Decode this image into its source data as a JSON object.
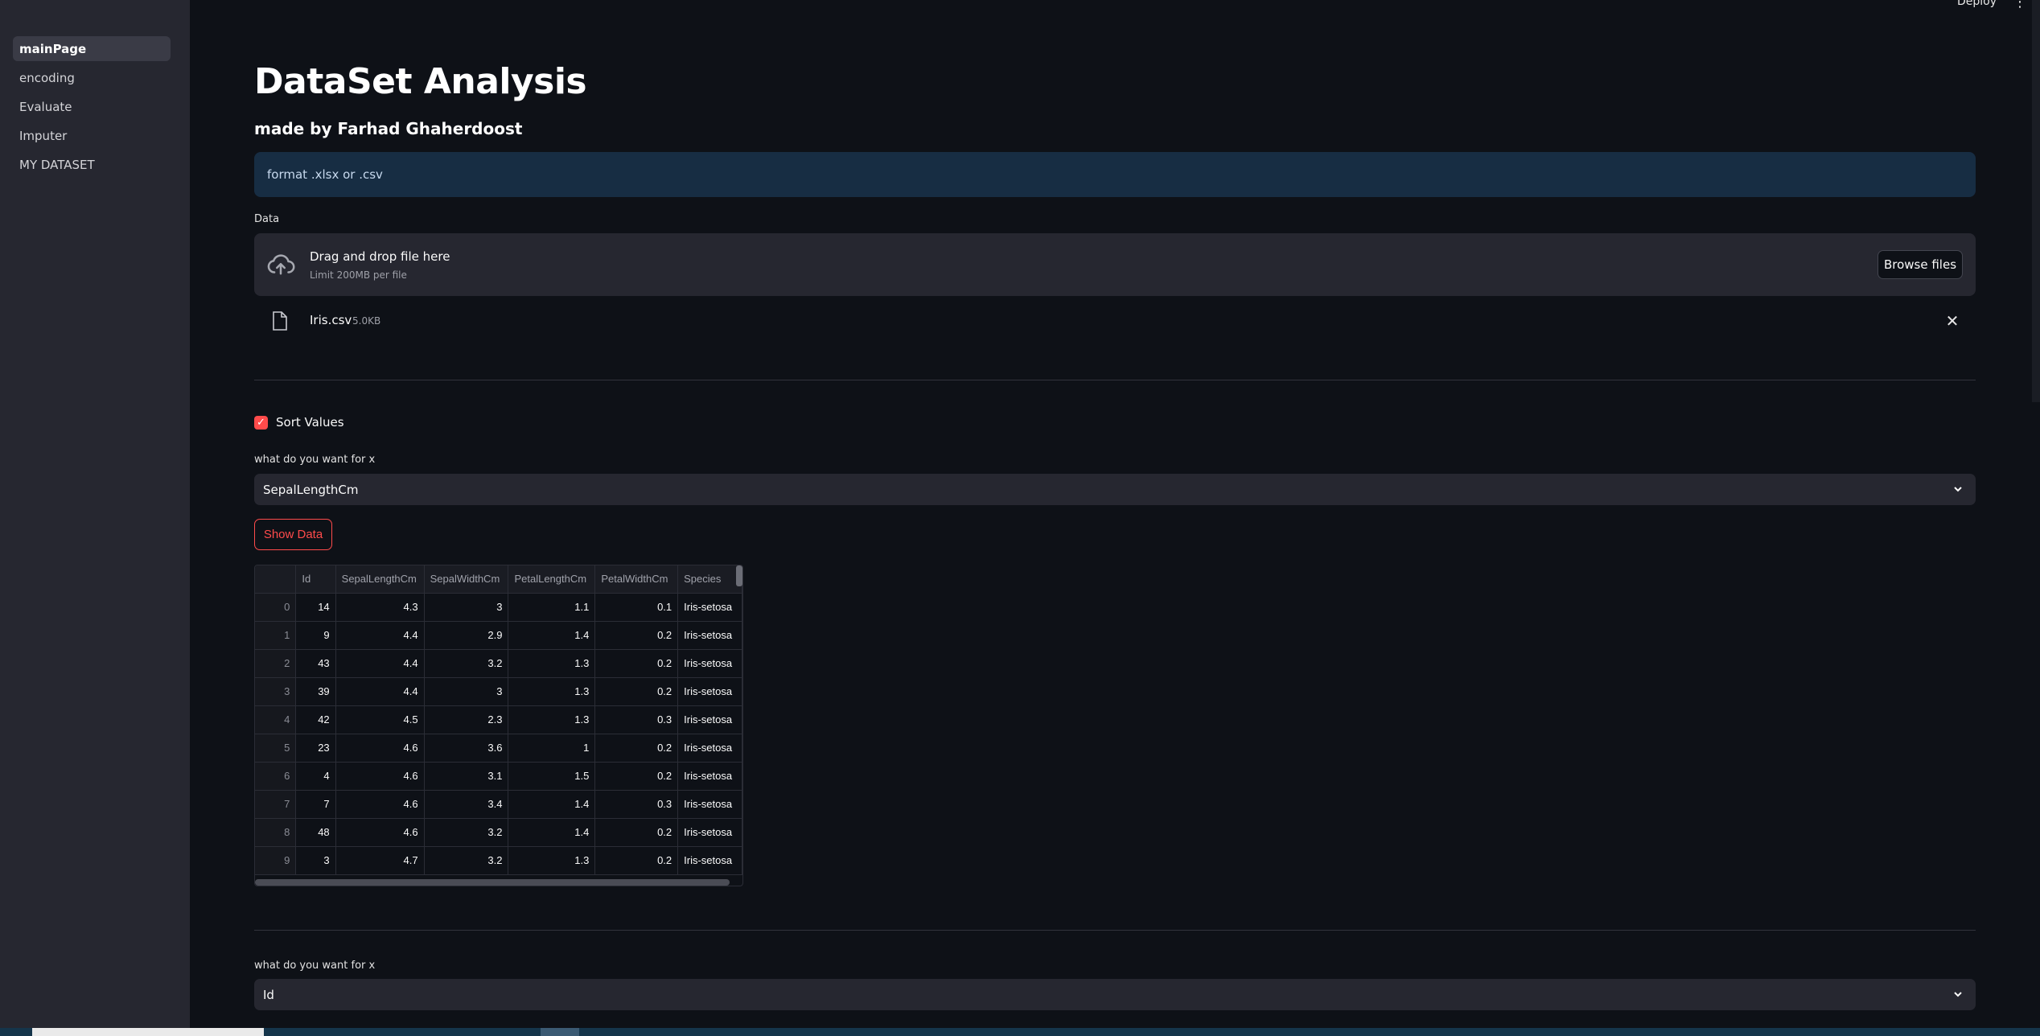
{
  "sidebar": {
    "items": [
      {
        "label": "mainPage",
        "active": true
      },
      {
        "label": "encoding"
      },
      {
        "label": "Evaluate"
      },
      {
        "label": "Imputer"
      },
      {
        "label": "MY DATASET"
      }
    ]
  },
  "header": {
    "deploy_label": "Deploy",
    "menu_icon": "kebab-icon"
  },
  "main": {
    "title": "DataSet Analysis",
    "subtitle": "made by Farhad Ghaherdoost",
    "info_text": "format .xlsx or .csv",
    "uploader": {
      "label": "Data",
      "drop_text": "Drag and drop file here",
      "limit_text": "Limit 200MB per file",
      "browse_label": "Browse files",
      "icon": "cloud-upload-icon"
    },
    "uploaded_file": {
      "name": "Iris.csv",
      "size": "5.0KB",
      "icon": "file-icon"
    },
    "sort_checkbox": {
      "label": "Sort Values",
      "checked": true
    },
    "select_x_1": {
      "label": "what do you want for x",
      "value": "SepalLengthCm"
    },
    "show_data_label": "Show Data",
    "select_x_2": {
      "label": "what do you want for x",
      "value": "Id"
    }
  },
  "table": {
    "columns": [
      "",
      "Id",
      "SepalLengthCm",
      "SepalWidthCm",
      "PetalLengthCm",
      "PetalWidthCm",
      "Species"
    ],
    "rows": [
      [
        "0",
        "14",
        "4.3",
        "3",
        "1.1",
        "0.1",
        "Iris-setosa"
      ],
      [
        "1",
        "9",
        "4.4",
        "2.9",
        "1.4",
        "0.2",
        "Iris-setosa"
      ],
      [
        "2",
        "43",
        "4.4",
        "3.2",
        "1.3",
        "0.2",
        "Iris-setosa"
      ],
      [
        "3",
        "39",
        "4.4",
        "3",
        "1.3",
        "0.2",
        "Iris-setosa"
      ],
      [
        "4",
        "42",
        "4.5",
        "2.3",
        "1.3",
        "0.3",
        "Iris-setosa"
      ],
      [
        "5",
        "23",
        "4.6",
        "3.6",
        "1",
        "0.2",
        "Iris-setosa"
      ],
      [
        "6",
        "4",
        "4.6",
        "3.1",
        "1.5",
        "0.2",
        "Iris-setosa"
      ],
      [
        "7",
        "7",
        "4.6",
        "3.4",
        "1.4",
        "0.3",
        "Iris-setosa"
      ],
      [
        "8",
        "48",
        "4.6",
        "3.2",
        "1.4",
        "0.2",
        "Iris-setosa"
      ],
      [
        "9",
        "3",
        "4.7",
        "3.2",
        "1.3",
        "0.2",
        "Iris-setosa"
      ]
    ]
  },
  "colors": {
    "background": "#0e1117",
    "sidebar": "#262730",
    "accent": "#ff4b4b",
    "info_bg": "#172d43"
  }
}
